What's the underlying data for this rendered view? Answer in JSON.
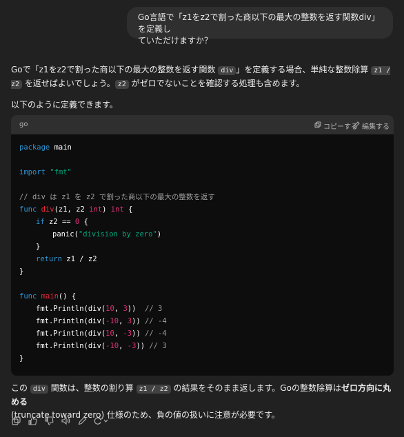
{
  "user_message": {
    "line1": "Go言語で「z1をz2で割った商以下の最大の整数を返す関数div」を定義し",
    "line2": "ていただけますか？"
  },
  "reply": {
    "p1": {
      "t1": "Goで「z1をz2で割った商以下の最大の整数を返す関数 ",
      "c1": "div",
      "t2": "」を定義する場合、単純な整数除算 ",
      "c2": "z1 / z2",
      "t3": " を返せばよいでしょう。",
      "c3": "z2",
      "t4": " がゼロでないことを確認する処理も含めます。"
    },
    "p2": "以下のように定義できます。",
    "p3": {
      "t1": "この ",
      "c1": "div",
      "t2": " 関数は、整数の割り算 ",
      "c2": "z1 / z2",
      "t3": " の結果をそのまま返します。Goの整数除算は",
      "b1": "ゼロ方向に丸める",
      "t4": "(truncate toward zero) 仕様のため、負の値の扱いに注意が必要です。"
    }
  },
  "code": {
    "language": "go",
    "copy_label": "コピーする",
    "edit_label": "編集する",
    "l1_kw": "package",
    "l1_name": "main",
    "l3_kw": "import",
    "l3_str": "\"fmt\"",
    "l5_comment": "// div は z1 を z2 で割った商以下の最大の整数を返す",
    "l6_kw": "func",
    "l6_fn": "div",
    "l6_params": "(z1, z2 ",
    "l6_type1": "int",
    "l6_mid": ") ",
    "l6_type2": "int",
    "l6_end": " {",
    "l7_kw": "if",
    "l7_cond": " z2 == ",
    "l7_num": "0",
    "l7_end": " {",
    "l8_fn": "panic(",
    "l8_str": "\"division by zero\"",
    "l8_end": ")",
    "l9": "}",
    "l10_kw": "return",
    "l10_expr": " z1 / z2",
    "l11": "}",
    "l13_kw": "func",
    "l13_fn": "main",
    "l13_end": "() {",
    "calls": [
      {
        "pre": "fmt.Println(div(",
        "a": "10",
        "sep": ", ",
        "b": "3",
        "post": "))  ",
        "comment": "// 3"
      },
      {
        "pre": "fmt.Println(div(",
        "a": "-10",
        "sep": ", ",
        "b": "3",
        "post": ")) ",
        "comment": "// -4"
      },
      {
        "pre": "fmt.Println(div(",
        "a": "10",
        "sep": ", ",
        "b": "-3",
        "post": ")) ",
        "comment": "// -4"
      },
      {
        "pre": "fmt.Println(div(",
        "a": "-10",
        "sep": ", ",
        "b": "-3",
        "post": ")) ",
        "comment": "// 3"
      }
    ],
    "l19": "}"
  },
  "icons": [
    "copy-icon",
    "thumbs-up-icon",
    "thumbs-down-icon",
    "read-aloud-icon",
    "edit-icon",
    "regenerate-icon"
  ]
}
